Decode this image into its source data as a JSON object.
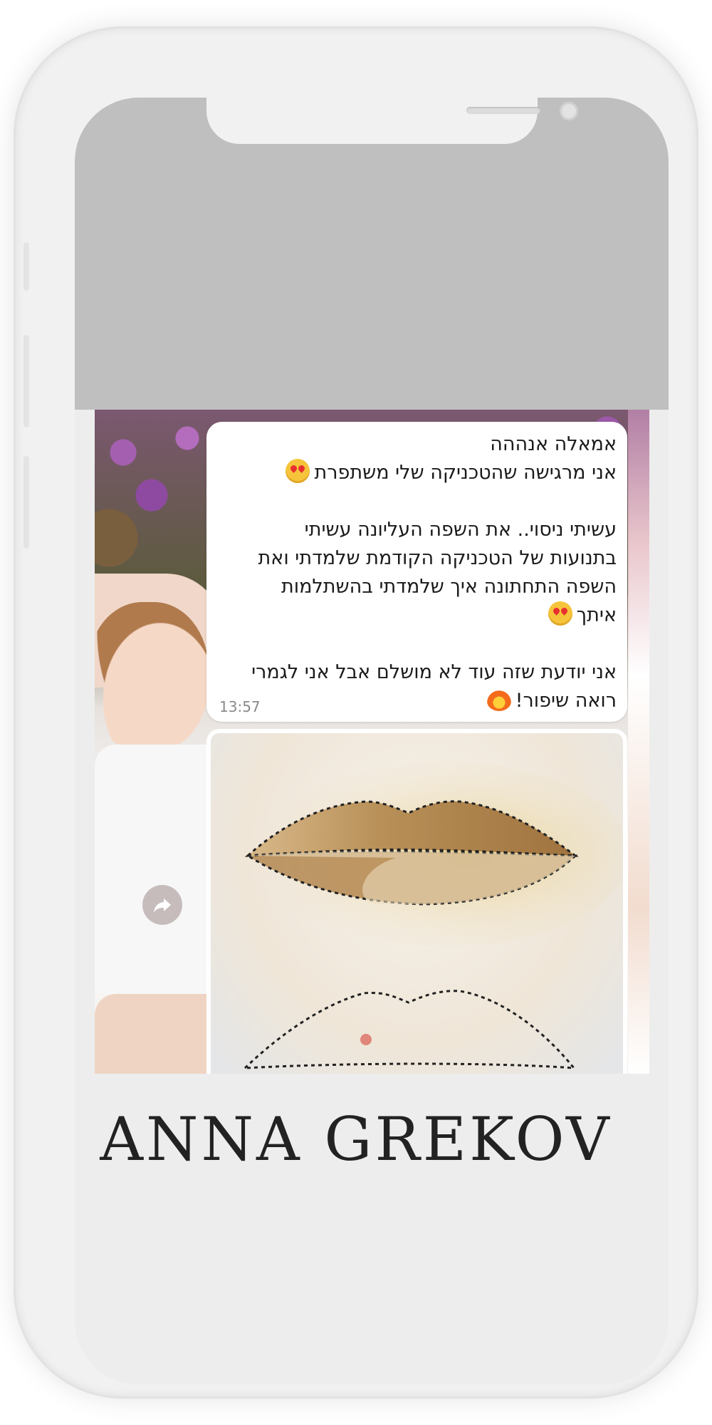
{
  "chat": {
    "lines": [
      "אמאלה אנההה",
      "אני מרגישה שהטכניקה שלי משתפרת",
      "עשיתי ניסוי.. את השפה העליונה עשיתי",
      "בתנועות של הטכניקה הקודמת שלמדתי ואת",
      "השפה התחתונה איך שלמדתי בהשתלמות",
      "איתך",
      "אני יודעת שזה עוד לא מושלם אבל אני לגמרי",
      "רואה שיפור!"
    ],
    "timestamp": "13:57",
    "emoji_1": "smiling-face-with-heart-eyes-icon",
    "emoji_2": "smiling-face-with-heart-eyes-icon",
    "emoji_3": "fire-icon",
    "share_icon": "forward-arrow-icon"
  },
  "brand": {
    "name": "ANNA GREKOV"
  }
}
